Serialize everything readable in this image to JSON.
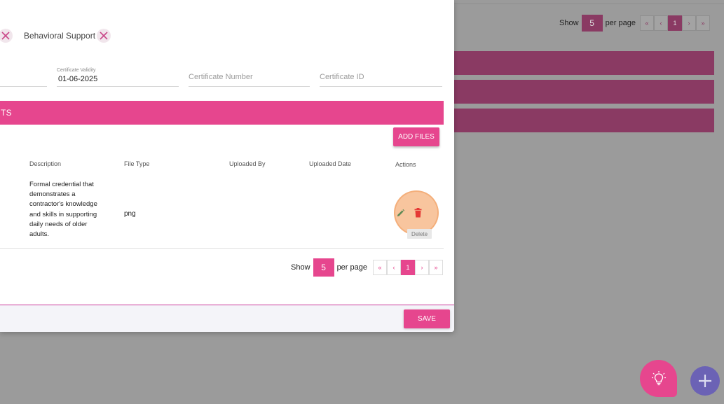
{
  "background": {
    "pagination": {
      "show_label": "Show",
      "page_size": "5",
      "per_page_label": "per page",
      "buttons": [
        "«",
        "‹",
        "1",
        "›",
        "»"
      ]
    }
  },
  "modal": {
    "chips": [
      {
        "label": "Behavioral Support"
      }
    ],
    "fields": {
      "certificate_validity": {
        "label": "Certificate Validity",
        "value": "01-06-2025"
      },
      "certificate_number": {
        "placeholder": "Certificate Number"
      },
      "certificate_id": {
        "placeholder": "Certificate ID"
      }
    },
    "section_title": "TS",
    "add_files_label": "ADD FILES",
    "table": {
      "headers": {
        "description": "Description",
        "file_type": "File Type",
        "uploaded_by": "Uploaded By",
        "uploaded_date": "Uploaded Date",
        "actions": "Actions"
      },
      "rows": [
        {
          "description": "Formal credential that demonstrates a contractor's knowledge and skills in supporting daily needs of older adults.",
          "file_type": "png",
          "uploaded_by": "",
          "uploaded_date": ""
        }
      ],
      "delete_tooltip": "Delete"
    },
    "pagination": {
      "show_label": "Show",
      "page_size": "5",
      "per_page_label": "per page",
      "buttons": [
        "«",
        "‹",
        "1",
        "›",
        "»"
      ]
    },
    "save_label": "SAVE"
  },
  "colors": {
    "accent": "#e6468e",
    "accent_dimmed": "#8a3a63",
    "fab_secondary": "#6b62b5",
    "highlight_ring": "#f6b17e"
  },
  "icons": {
    "chip_remove": "close-icon",
    "edit": "pencil-icon",
    "delete": "trash-icon",
    "fab_left": "lightbulb-icon",
    "fab_right": "plus-icon"
  }
}
